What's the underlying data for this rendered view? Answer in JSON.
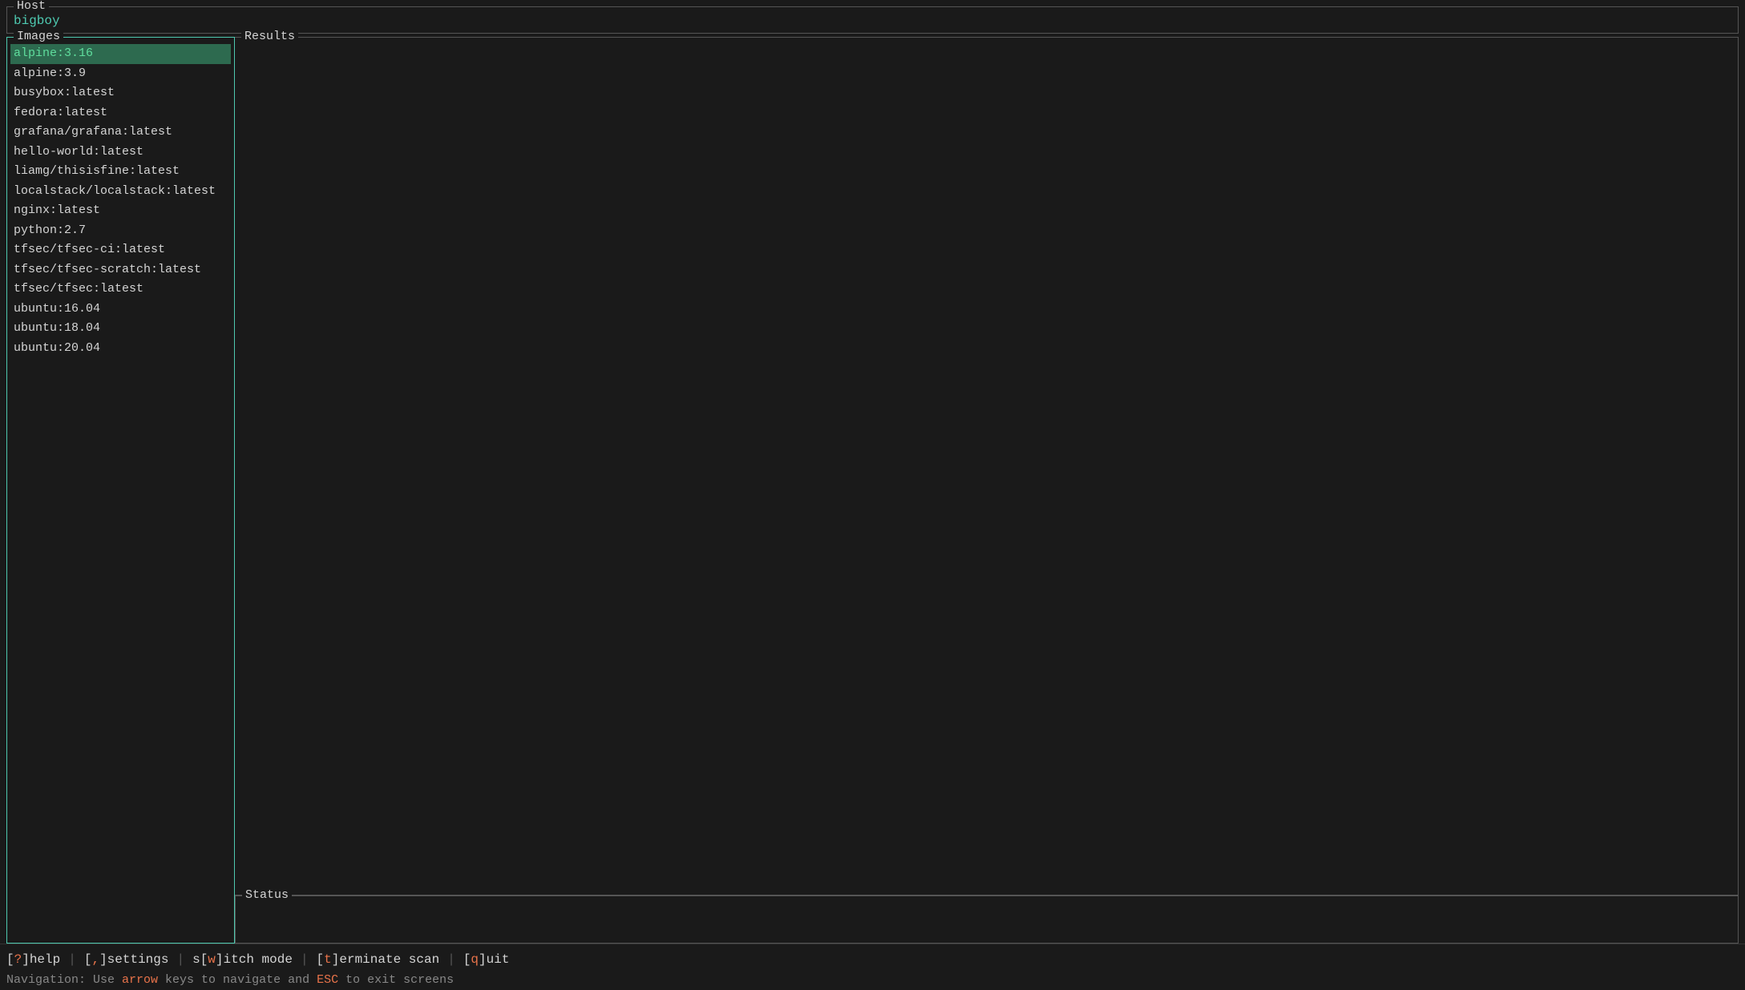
{
  "host": {
    "label": "Host",
    "value": "bigboy"
  },
  "images": {
    "label": "Images",
    "selected_index": 0,
    "items": [
      "alpine:3.16",
      "alpine:3.9",
      "busybox:latest",
      "fedora:latest",
      "grafana/grafana:latest",
      "hello-world:latest",
      "liamg/thisisfine:latest",
      "localstack/localstack:latest",
      "nginx:latest",
      "python:2.7",
      "tfsec/tfsec-ci:latest",
      "tfsec/tfsec-scratch:latest",
      "tfsec/tfsec:latest",
      "ubuntu:16.04",
      "ubuntu:18.04",
      "ubuntu:20.04"
    ]
  },
  "results": {
    "label": "Results",
    "content": ""
  },
  "status": {
    "label": "Status",
    "content": ""
  },
  "footer": {
    "shortcuts": [
      {
        "id": "help",
        "prefix": "[",
        "key": "?",
        "suffix": "]",
        "text": " help"
      },
      {
        "id": "settings",
        "prefix": "[",
        "key": ",",
        "suffix": "]",
        "text": " settings"
      },
      {
        "id": "switch",
        "prefix": "s[",
        "key": "w",
        "suffix": "]",
        "text": "itch mode"
      },
      {
        "id": "terminate",
        "prefix": "[",
        "key": "t",
        "suffix": "]",
        "text": "erminate scan"
      },
      {
        "id": "quit",
        "prefix": "[",
        "key": "q",
        "suffix": "]",
        "text": "uit"
      }
    ],
    "separator": "|",
    "navigation": {
      "prefix": "Navigation: Use ",
      "arrow_text": "arrow",
      "middle": " keys to navigate ",
      "and_text": "and",
      "space": " ",
      "to_text": "to",
      "suffix": " exit screens",
      "esc_text": "ESC"
    }
  }
}
